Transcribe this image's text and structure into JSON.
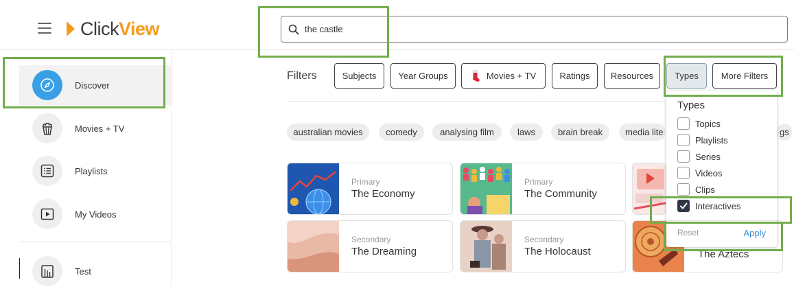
{
  "app": {
    "logo_click": "Click",
    "logo_view": "View"
  },
  "search": {
    "value": "the castle"
  },
  "sidebar": {
    "items": [
      {
        "label": "Discover",
        "icon": "compass-icon",
        "active": true
      },
      {
        "label": "Movies + TV",
        "icon": "popcorn-icon"
      },
      {
        "label": "Playlists",
        "icon": "playlist-icon"
      },
      {
        "label": "My Videos",
        "icon": "play-icon"
      },
      {
        "label": "Test",
        "icon": "chart-icon"
      }
    ]
  },
  "filters": {
    "label": "Filters",
    "buttons": [
      "Subjects",
      "Year Groups",
      "Movies + TV",
      "Ratings",
      "Resources",
      "Types",
      "More Filters"
    ]
  },
  "tags": [
    "australian movies",
    "comedy",
    "analysing film",
    "laws",
    "brain break",
    "media lite",
    "gs"
  ],
  "cards": [
    {
      "level": "Primary",
      "title": "The Economy"
    },
    {
      "level": "Primary",
      "title": "The Community"
    },
    {
      "level": "Secondary",
      "title": "The Dreaming"
    },
    {
      "level": "Secondary",
      "title": "The Holocaust"
    },
    {
      "title": "The Aztecs"
    }
  ],
  "types_dropdown": {
    "title": "Types",
    "options": [
      {
        "label": "Topics",
        "checked": false
      },
      {
        "label": "Playlists",
        "checked": false
      },
      {
        "label": "Series",
        "checked": false
      },
      {
        "label": "Videos",
        "checked": false
      },
      {
        "label": "Clips",
        "checked": false
      },
      {
        "label": "Interactives",
        "checked": true
      }
    ],
    "reset": "Reset",
    "apply": "Apply"
  },
  "colors": {
    "accent_orange": "#f59a1b",
    "discover_blue": "#3aa0e6",
    "apply_blue": "#3a8fd6",
    "highlight_green": "#72ad4c"
  }
}
